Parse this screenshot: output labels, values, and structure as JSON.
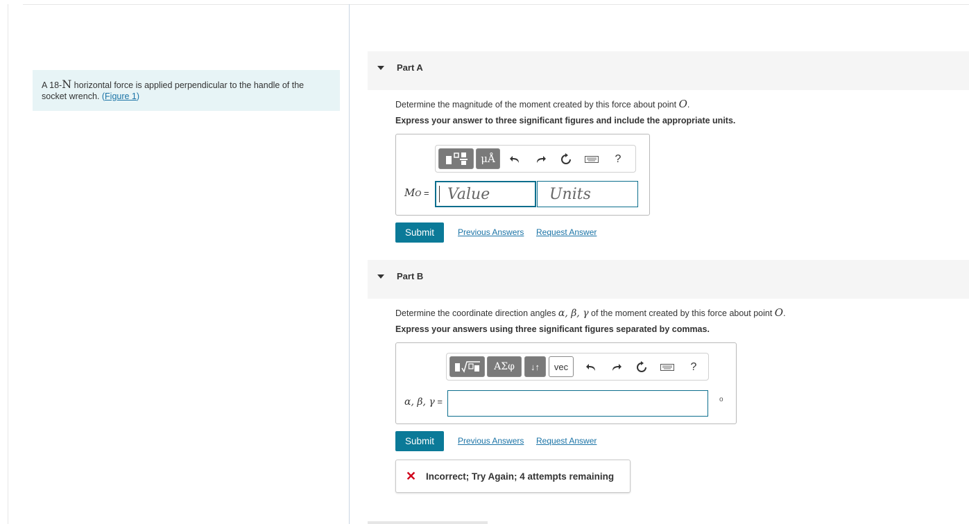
{
  "problem": {
    "text_before": "A 18-",
    "unit_symbol": "N",
    "text_after": " horizontal force is applied perpendicular to the handle of the socket wrench.",
    "figure_open": "(",
    "figure_link": "Figure 1",
    "figure_close": ")"
  },
  "partA": {
    "title": "Part A",
    "question_prefix": "Determine the magnitude of the moment created by this force about point ",
    "question_point": "O",
    "question_suffix": ".",
    "instruction": "Express your answer to three significant figures and include the appropriate units.",
    "toolbar": {
      "units_button": "μÅ",
      "help": "?"
    },
    "answer_label_main": "M",
    "answer_label_sub": "O",
    "answer_label_eq": " =",
    "value_placeholder": "Value",
    "units_placeholder": "Units",
    "submit": "Submit",
    "previous_answers": "Previous Answers",
    "request_answer": "Request Answer"
  },
  "partB": {
    "title": "Part B",
    "question_prefix": "Determine the coordinate direction angles ",
    "question_angles": "α, β, γ",
    "question_mid": " of the moment created by this force about point ",
    "question_point": "O",
    "question_suffix": ".",
    "instruction": "Express your answers using three significant figures separated by commas.",
    "toolbar": {
      "greek_button": "ΑΣφ",
      "sort_button": "↓↑",
      "vec_button": "vec",
      "help": "?"
    },
    "answer_label": "α, β, γ",
    "answer_label_eq": " =",
    "degree_symbol": "o",
    "submit": "Submit",
    "previous_answers": "Previous Answers",
    "request_answer": "Request Answer",
    "feedback": "Incorrect; Try Again; 4 attempts remaining"
  },
  "colors": {
    "submit_bg": "#0b7a98",
    "link": "#1a73a6",
    "problem_bg": "#e7f4f6",
    "error": "#d0021b"
  }
}
